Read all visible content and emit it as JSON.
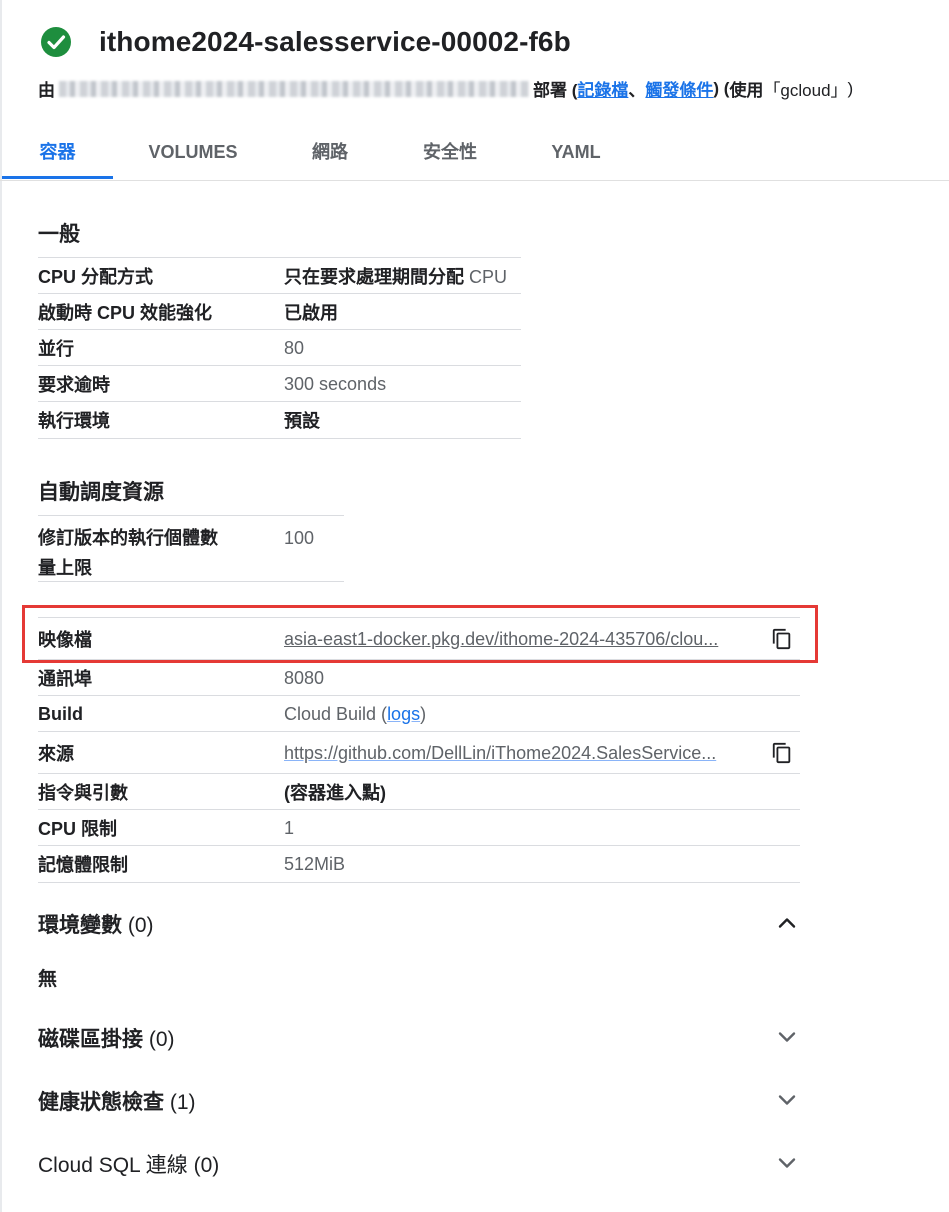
{
  "header": {
    "title": "ithome2024-salesservice-00002-f6b",
    "status_icon": "check-circle-icon",
    "status_color": "#1e8e3e"
  },
  "subtitle": {
    "prefix": "由",
    "deploy": "部署 (",
    "logs_link": "記錄檔",
    "separator": "、",
    "trigger_link": "觸發條件",
    "suffix_1": ") (",
    "use": "使用",
    "gcloud": "「gcloud」",
    "suffix_2": ")"
  },
  "tabs": [
    "容器",
    "VOLUMES",
    "網路",
    "安全性",
    "YAML"
  ],
  "general": {
    "title": "一般",
    "rows": [
      {
        "key": "CPU 分配方式",
        "value_bold": "只在要求處理期間分配",
        "value": " CPU"
      },
      {
        "key": "啟動時 CPU 效能強化",
        "value_bold": "已啟用",
        "value": ""
      },
      {
        "key": "並行",
        "value_bold": "",
        "value": "80"
      },
      {
        "key": "要求逾時",
        "value_bold": "",
        "value": "300 seconds"
      },
      {
        "key": "執行環境",
        "value_bold": "預設",
        "value": ""
      }
    ]
  },
  "autoscale": {
    "title": "自動調度資源",
    "key_line1": "修訂版本的執行個體數",
    "key_line2": "量上限",
    "value": "100"
  },
  "container": {
    "image_key": "映像檔",
    "image_value": "asia-east1-docker.pkg.dev/ithome-2024-435706/clou...",
    "port_key": "通訊埠",
    "port_value": "8080",
    "build_key": "Build",
    "build_value": "Cloud Build (",
    "build_link": "logs",
    "build_suffix": ")",
    "source_key": "來源",
    "source_value": "https://github.com/DellLin/iThome2024.SalesService...",
    "cmd_key": "指令與引數",
    "cmd_value": "(容器進入點)",
    "cpu_key": "CPU 限制",
    "cpu_value": "1",
    "mem_key": "記憶體限制",
    "mem_value": "512MiB"
  },
  "env": {
    "label_bold": "環境變數",
    "label_count": " (0)",
    "empty": "無"
  },
  "accordions": [
    {
      "label_bold": "磁碟區掛接",
      "label_count": " (0)"
    },
    {
      "label_bold": "健康狀態檢查",
      "label_count": " (1)"
    },
    {
      "label_bold": "Cloud SQL 連線",
      "label_count": " (0)"
    }
  ],
  "colors": {
    "accent": "#1a73e8",
    "highlight_box": "#e53935",
    "visited_link": "#681da8"
  }
}
